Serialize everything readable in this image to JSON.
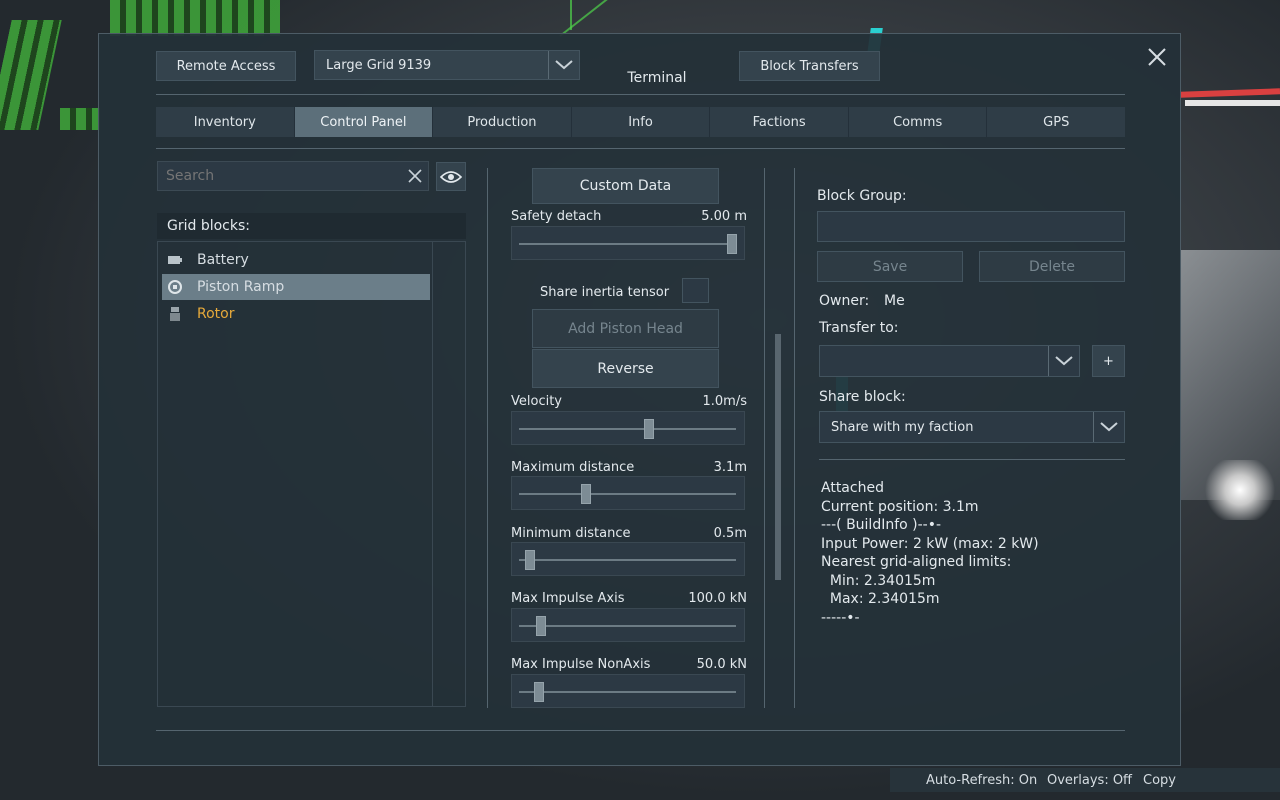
{
  "window": {
    "title": "Terminal",
    "remote_access": "Remote Access",
    "grid_select": "Large Grid 9139",
    "block_transfers": "Block Transfers"
  },
  "tabs": [
    {
      "label": "Inventory"
    },
    {
      "label": "Control Panel",
      "active": true
    },
    {
      "label": "Production"
    },
    {
      "label": "Info"
    },
    {
      "label": "Factions"
    },
    {
      "label": "Comms"
    },
    {
      "label": "GPS"
    }
  ],
  "search": {
    "placeholder": "Search"
  },
  "grid_blocks": {
    "header": "Grid blocks:",
    "items": [
      {
        "label": "Battery",
        "icon": "battery-icon"
      },
      {
        "label": "Piston Ramp",
        "icon": "piston-icon",
        "selected": true
      },
      {
        "label": "Rotor",
        "icon": "rotor-icon",
        "status_color": "#e6a93a"
      }
    ]
  },
  "control": {
    "custom_data": "Custom Data",
    "safety_detach": {
      "label": "Safety detach",
      "value": "5.00 m",
      "fraction": 0.98
    },
    "share_inertia": "Share inertia tensor",
    "add_piston_head": "Add Piston Head",
    "reverse": "Reverse",
    "velocity": {
      "label": "Velocity",
      "value": "1.0m/s",
      "fraction": 0.6
    },
    "max_distance": {
      "label": "Maximum distance",
      "value": "3.1m",
      "fraction": 0.31
    },
    "min_distance": {
      "label": "Minimum distance",
      "value": "0.5m",
      "fraction": 0.05
    },
    "max_impulse_axis": {
      "label": "Max Impulse Axis",
      "value": "100.0 kN",
      "fraction": 0.1
    },
    "max_impulse_nonaxis": {
      "label": "Max Impulse NonAxis",
      "value": "50.0 kN",
      "fraction": 0.09
    }
  },
  "right": {
    "block_group_label": "Block Group:",
    "save": "Save",
    "delete": "Delete",
    "owner_label": "Owner:",
    "owner_value": "Me",
    "transfer_label": "Transfer to:",
    "plus": "+",
    "share_label": "Share block:",
    "share_value": "Share with my faction",
    "info": "Attached\nCurrent position: 3.1m\n---( BuildInfo )--•-\nInput Power: 2 kW (max: 2 kW)\nNearest grid-aligned limits:\n  Min: 2.34015m\n  Max: 2.34015m\n-----•-"
  },
  "statusbar": {
    "auto_refresh": "Auto-Refresh: On",
    "overlays": "Overlays: Off",
    "copy": "Copy"
  }
}
